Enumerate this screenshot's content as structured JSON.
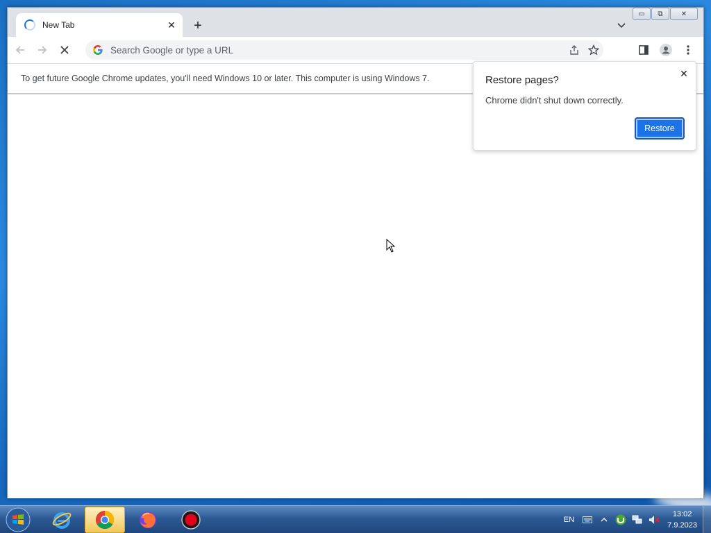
{
  "browser": {
    "tab": {
      "title": "New Tab",
      "close_glyph": "✕"
    },
    "new_tab_glyph": "+",
    "window_controls": {
      "minimize": "▭",
      "restore": "⧉",
      "close": "✕"
    },
    "omnibox": {
      "placeholder": "Search Google or type a URL"
    },
    "icons": [
      "back-arrow-icon",
      "forward-arrow-icon",
      "stop-icon",
      "google-g-icon",
      "share-icon",
      "star-icon",
      "side-panel-icon",
      "profile-icon",
      "menu-icon"
    ]
  },
  "infobar": {
    "message": "To get future Google Chrome updates, you'll need Windows 10 or later. This computer is using Windows 7."
  },
  "restore_bubble": {
    "title": "Restore pages?",
    "message": "Chrome didn't shut down correctly.",
    "button": "Restore",
    "close_glyph": "✕"
  },
  "taskbar": {
    "apps": [
      "internet-explorer",
      "chrome",
      "firefox",
      "recorder"
    ],
    "active_app": "chrome",
    "tray": {
      "language": "EN"
    },
    "clock": {
      "time": "13:02",
      "date": "7.9.2023"
    }
  },
  "colors": {
    "accent": "#1a73e8",
    "taskbar": "#2d5a94"
  }
}
